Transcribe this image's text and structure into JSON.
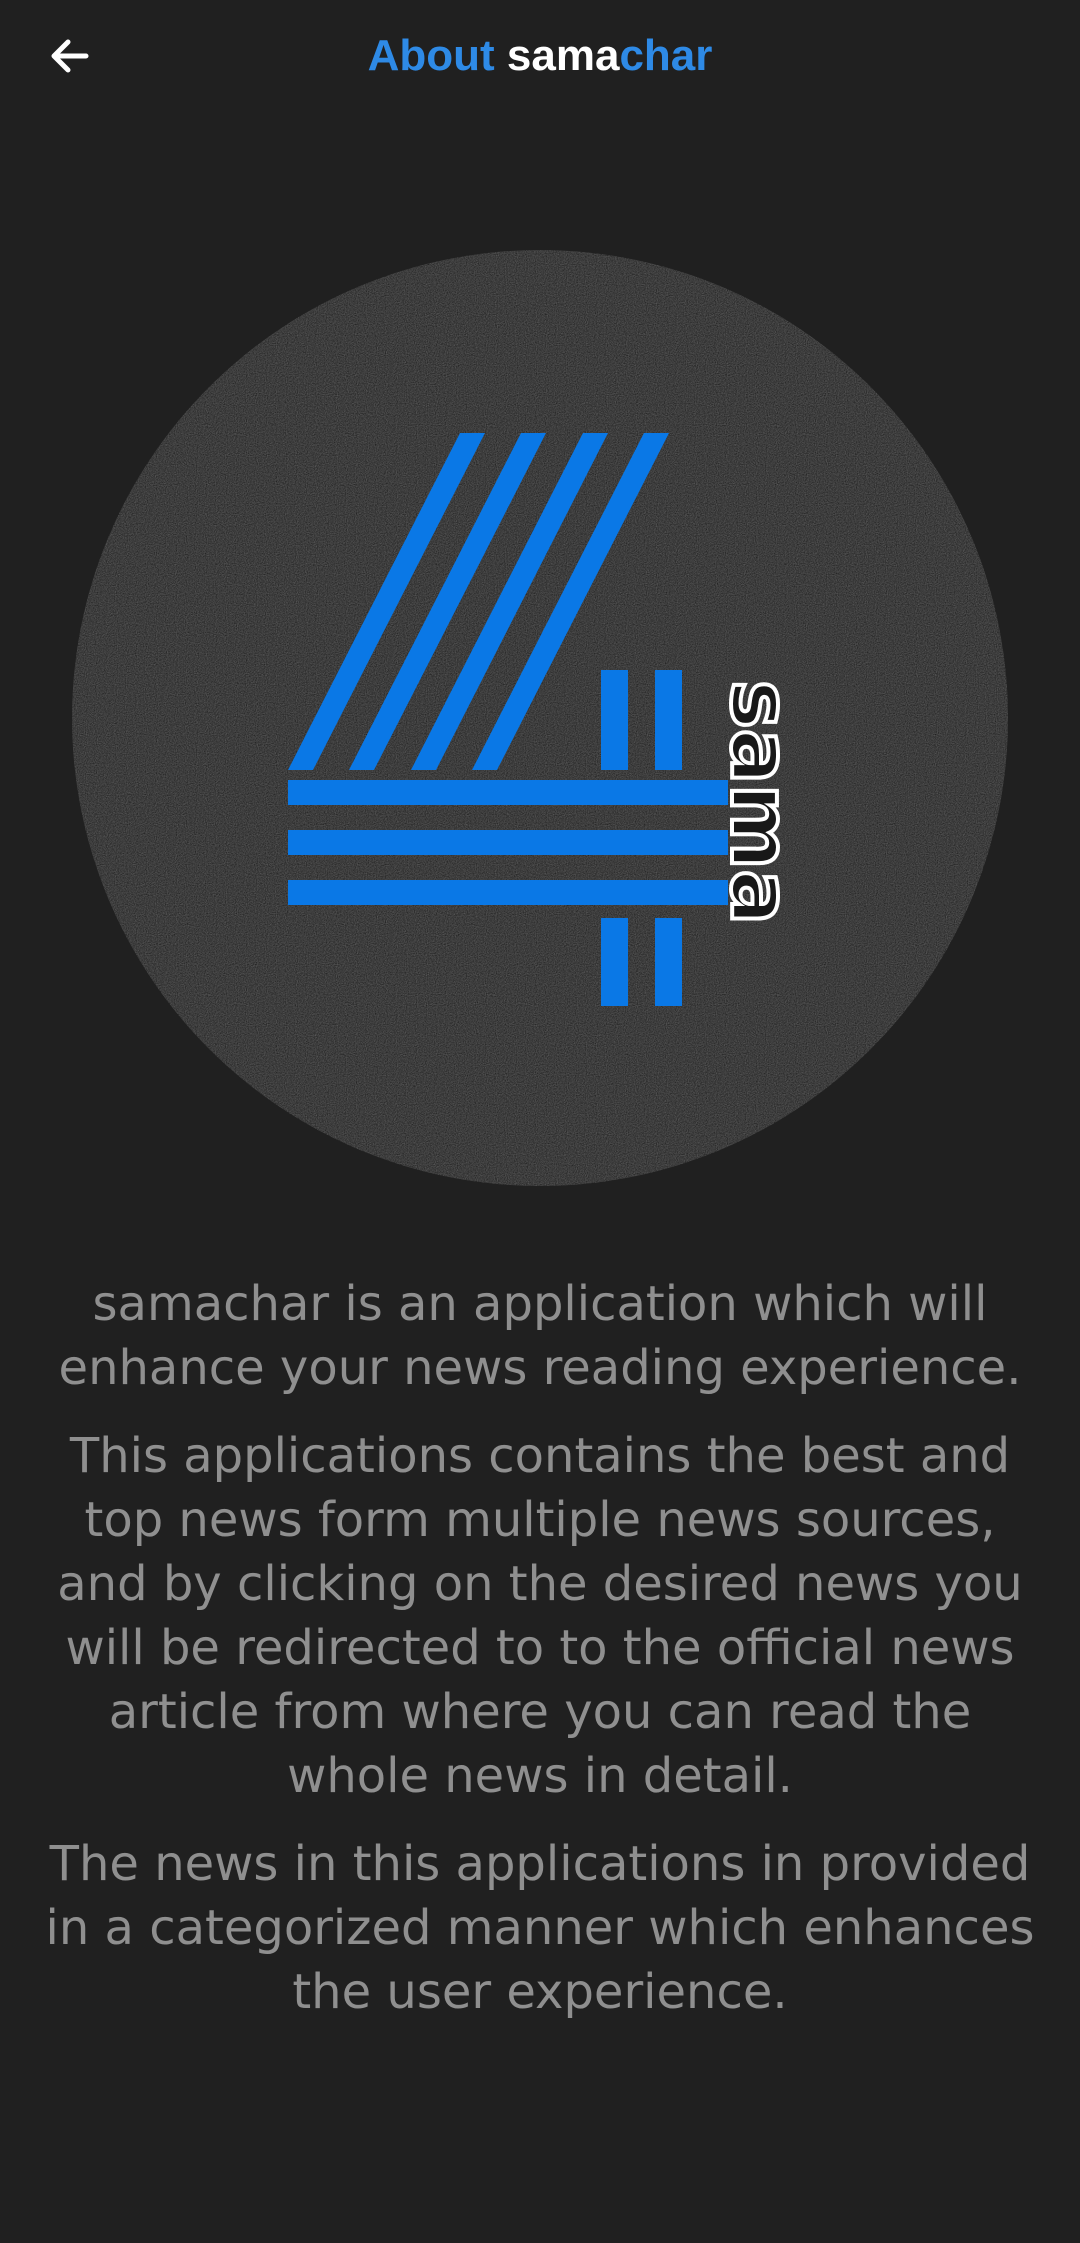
{
  "app_bar": {
    "back_icon": "arrow-left-icon",
    "title_part1": "About ",
    "title_part2": "sama",
    "title_part3": "char",
    "accent_color": "#2e8ae6",
    "title_highlight_color": "#ffffff"
  },
  "logo": {
    "icon": "samachar-logo-icon",
    "wordmark": "sama",
    "accent_color": "#0a78e6",
    "background_color": "#181818"
  },
  "about": {
    "paragraph_1": "samachar is an application which will enhance your news reading experience.",
    "paragraph_2": "This applications contains the best and top news form multiple news sources, and by clicking on the desired news you will be redirected to to the official news article from where you can read the whole news in detail.",
    "paragraph_3": "The news in this applications in provided in a categorized manner which enhances the user experience."
  }
}
